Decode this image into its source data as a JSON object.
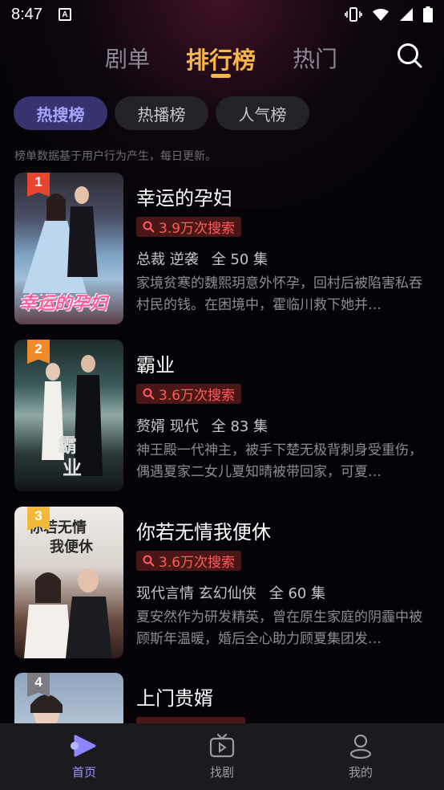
{
  "status_bar": {
    "time": "8:47",
    "notification_icon": "A"
  },
  "top_tabs": [
    {
      "label": "剧单"
    },
    {
      "label": "排行榜"
    },
    {
      "label": "热门"
    }
  ],
  "chips": [
    {
      "label": "热搜榜"
    },
    {
      "label": "热播榜"
    },
    {
      "label": "人气榜"
    }
  ],
  "notice": "榜单数据基于用户行为产生，每日更新。",
  "items": [
    {
      "rank": "1",
      "title": "幸运的孕妇",
      "poster_title": "幸运的孕妇",
      "search_count": "3.9万次搜索",
      "tags": "总裁 逆袭",
      "episodes": "全 50 集",
      "desc": "家境贫寒的魏熙玥意外怀孕，回村后被陷害私吞村民的钱。在困境中，霍临川救下她并…",
      "badge_color": "#e8452f"
    },
    {
      "rank": "2",
      "title": "霸业",
      "poster_title": "霸业",
      "search_count": "3.6万次搜索",
      "tags": "赘婿 现代",
      "episodes": "全 83 集",
      "desc": "神王殿一代神主，被手下楚无极背刺身受重伤，偶遇夏家二女儿夏知晴被带回家，可夏…",
      "badge_color": "#f08a2a"
    },
    {
      "rank": "3",
      "title": "你若无情我便休",
      "poster_title": "你若无情我便休",
      "search_count": "3.6万次搜索",
      "tags": "现代言情 玄幻仙侠",
      "episodes": "全 60 集",
      "desc": "夏安然作为研发精英，曾在原生家庭的阴霾中被顾斯年温暖，婚后全心助力顾夏集团发…",
      "badge_color": "#f2b83a"
    },
    {
      "rank": "4",
      "title": "上门贵婿",
      "poster_title": "",
      "search_count": "",
      "tags": "",
      "episodes": "",
      "desc": "",
      "badge_color": "#7c7c84"
    }
  ],
  "bottom_nav": [
    {
      "label": "首页",
      "icon": "play-home-icon"
    },
    {
      "label": "找剧",
      "icon": "tv-icon"
    },
    {
      "label": "我的",
      "icon": "user-icon"
    }
  ],
  "colors": {
    "accent": "#f7b64a",
    "chip_active_bg": "#36336e",
    "chip_active_text": "#a9a4ff",
    "search_count_bg": "#4a1717",
    "search_count_text": "#ff5c5c",
    "nav_active": "#9e95ff"
  }
}
